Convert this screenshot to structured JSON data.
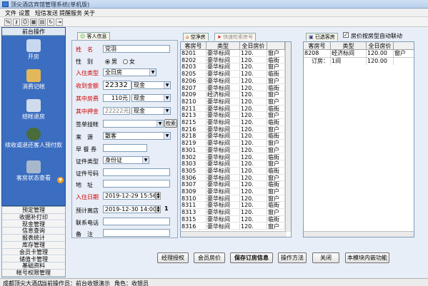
{
  "window": {
    "title": "顶尖酒店宾馆管理系统(单机版)"
  },
  "menu": [
    "文件",
    "设置",
    "短信发送",
    "提醒服务",
    "关于"
  ],
  "toolbar_icons": [
    "percent-icon",
    "key-icon",
    "users-icon",
    "grid-icon",
    "book-icon",
    "refresh-icon",
    "exit-icon"
  ],
  "left": {
    "header": "前台操作",
    "buttons": [
      {
        "label": "开房",
        "icon": "pen-icon"
      },
      {
        "label": "消费记帐",
        "icon": "bottles-icon"
      },
      {
        "label": "结帐退房",
        "icon": "checkout-icon"
      },
      {
        "label": "续收或退还客人预付款",
        "icon": "moneybag-icon"
      },
      {
        "label": "客房状态查看",
        "icon": "room-status-icon"
      }
    ],
    "list": [
      "预定管理",
      "收据补打印",
      "现金管理",
      "信息查询",
      "报表统计",
      "库存管理",
      "会员卡管理",
      "储值卡管理",
      "基础资料",
      "帐号权限管理"
    ]
  },
  "form": {
    "tab": "客人信息",
    "name_label": "姓　名",
    "name_value": "党羽",
    "gender_label": "性　别",
    "male": "男",
    "female": "女",
    "roomtype_label": "入住类型",
    "roomtype_value": "全日房",
    "received_label": "收到金额",
    "received_value": "22332",
    "received_mode": "现金",
    "rent_label": "其中房费",
    "rent_value": "110元",
    "rent_mode": "现金",
    "deposit_label": "其中押金",
    "deposit_value": "22222元",
    "deposit_mode": "现金",
    "sign_label": "签单挂帐",
    "search_btn": "检索",
    "source_label": "来　源",
    "source_value": "散客",
    "breakfast_label": "早 餐 券",
    "idtype_label": "证件类型",
    "idtype_value": "身份证",
    "idno_label": "证件号码",
    "address_label": "地　址",
    "checkin_label": "入住日期",
    "checkin_value": "2019-12-29 15:56",
    "checkout_label": "预计离店",
    "checkout_value": "2019-12-30 14:00",
    "days": "1",
    "phone_label": "联系电话",
    "remark_label": "备　注"
  },
  "rooms": {
    "tabs": [
      "空净房",
      "快速检索房号"
    ],
    "headers": [
      "客房号",
      "类型",
      "全日房价",
      ""
    ],
    "rows": [
      [
        "8201",
        "豪华标间",
        "120.",
        "窗户"
      ],
      [
        "8202",
        "豪华标间",
        "120.",
        "临街"
      ],
      [
        "8203",
        "豪华标间",
        "120.",
        "窗户"
      ],
      [
        "8205",
        "豪华标间",
        "120.",
        "临街"
      ],
      [
        "8206",
        "豪华标间",
        "120.",
        "窗户"
      ],
      [
        "8207",
        "豪华标间",
        "120.",
        "临街"
      ],
      [
        "8209",
        "经济标间",
        "120.",
        "窗户"
      ],
      [
        "8210",
        "豪华标间",
        "120.",
        "窗户"
      ],
      [
        "8211",
        "豪华标间",
        "120.",
        "临街"
      ],
      [
        "8213",
        "豪华标间",
        "120.",
        "窗户"
      ],
      [
        "8215",
        "豪华标间",
        "120.",
        "临街"
      ],
      [
        "8216",
        "豪华标间",
        "120.",
        "窗户"
      ],
      [
        "8218",
        "豪华标间",
        "120.",
        "临街"
      ],
      [
        "8219",
        "豪华标间",
        "120.",
        "窗户"
      ],
      [
        "8301",
        "豪华标间",
        "120.",
        "窗户"
      ],
      [
        "8302",
        "豪华标间",
        "120.",
        "临街"
      ],
      [
        "8303",
        "豪华标间",
        "120.",
        "窗户"
      ],
      [
        "8305",
        "豪华标间",
        "120.",
        "临街"
      ],
      [
        "8306",
        "豪华标间",
        "120.",
        "窗户"
      ],
      [
        "8307",
        "豪华标间",
        "120.",
        "临街"
      ],
      [
        "8309",
        "豪华标间",
        "120.",
        "窗户"
      ],
      [
        "8310",
        "豪华标间",
        "120.",
        "窗户"
      ],
      [
        "8311",
        "豪华标间",
        "120.",
        "临街"
      ],
      [
        "8313",
        "豪华标间",
        "120.",
        "窗户"
      ],
      [
        "8315",
        "豪华标间",
        "120.",
        "临街"
      ],
      [
        "8316",
        "豪华标间",
        "120.",
        "窗户"
      ]
    ]
  },
  "selected": {
    "tab": "已选客房",
    "checkbox_label": "房价按房型自动联动",
    "headers": [
      "客房号",
      "类型",
      "全日房价"
    ],
    "rows": [
      [
        "8208",
        "经济标间",
        "120.00",
        "窗户"
      ]
    ],
    "summary": [
      "订房：",
      "1间",
      "120.00"
    ]
  },
  "buttons": [
    "经理授权",
    "会员房价",
    "保存订房信息",
    "操作方法",
    "关闭",
    "本模块内嵌功能"
  ],
  "status": {
    "hotel": "成都顶尖大酒店",
    "operator": "当前操作员：前台收银演示",
    "role": "角色：收银员"
  }
}
